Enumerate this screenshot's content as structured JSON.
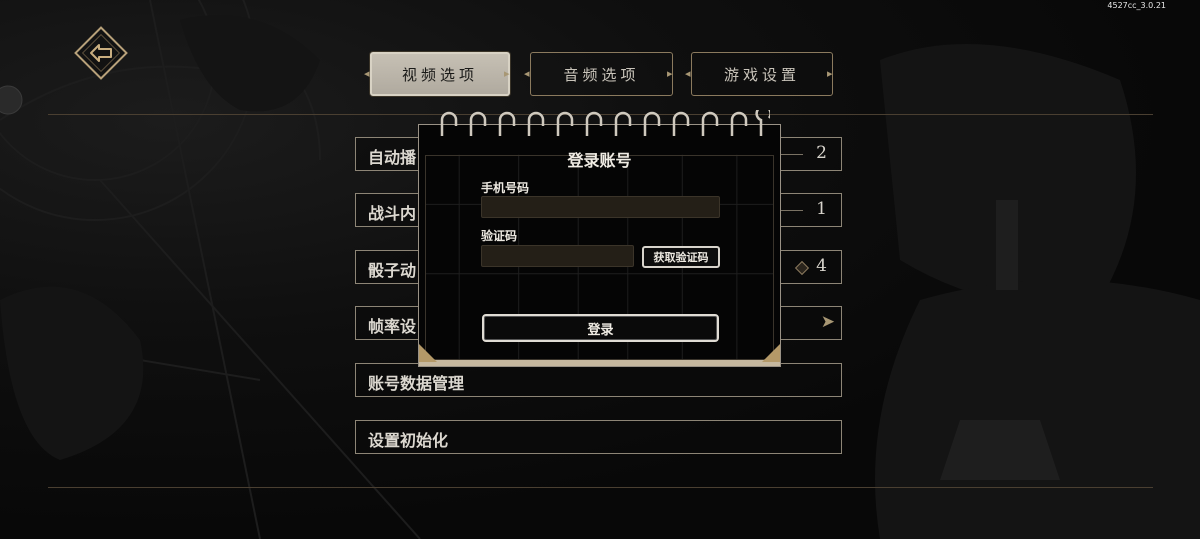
{
  "version": "4527cc_3.0.21",
  "icons": {
    "back": "back-arrow-icon",
    "tab_left": "diamond-arrow-left-icon",
    "tab_right": "diamond-arrow-right-icon",
    "chevron": "chevron-right-icon"
  },
  "tabs": [
    {
      "label": "视频选项",
      "active": true
    },
    {
      "label": "音频选项",
      "active": false
    },
    {
      "label": "游戏设置",
      "active": false
    }
  ],
  "settings": [
    {
      "label": "自动播",
      "value": "2"
    },
    {
      "label": "战斗内",
      "value": "1"
    },
    {
      "label": "骰子动",
      "value": "4"
    },
    {
      "label": "帧率设",
      "value": ""
    },
    {
      "label": "账号数据管理",
      "value": ""
    },
    {
      "label": "设置初始化",
      "value": ""
    }
  ],
  "login_modal": {
    "title": "登录账号",
    "phone_label": "手机号码",
    "phone_value": "",
    "code_label": "验证码",
    "code_value": "",
    "get_code_button": "获取验证码",
    "submit_button": "登录"
  },
  "colors": {
    "accent_gold": "#a89774",
    "frame": "#8d8576",
    "background": "#090909"
  }
}
